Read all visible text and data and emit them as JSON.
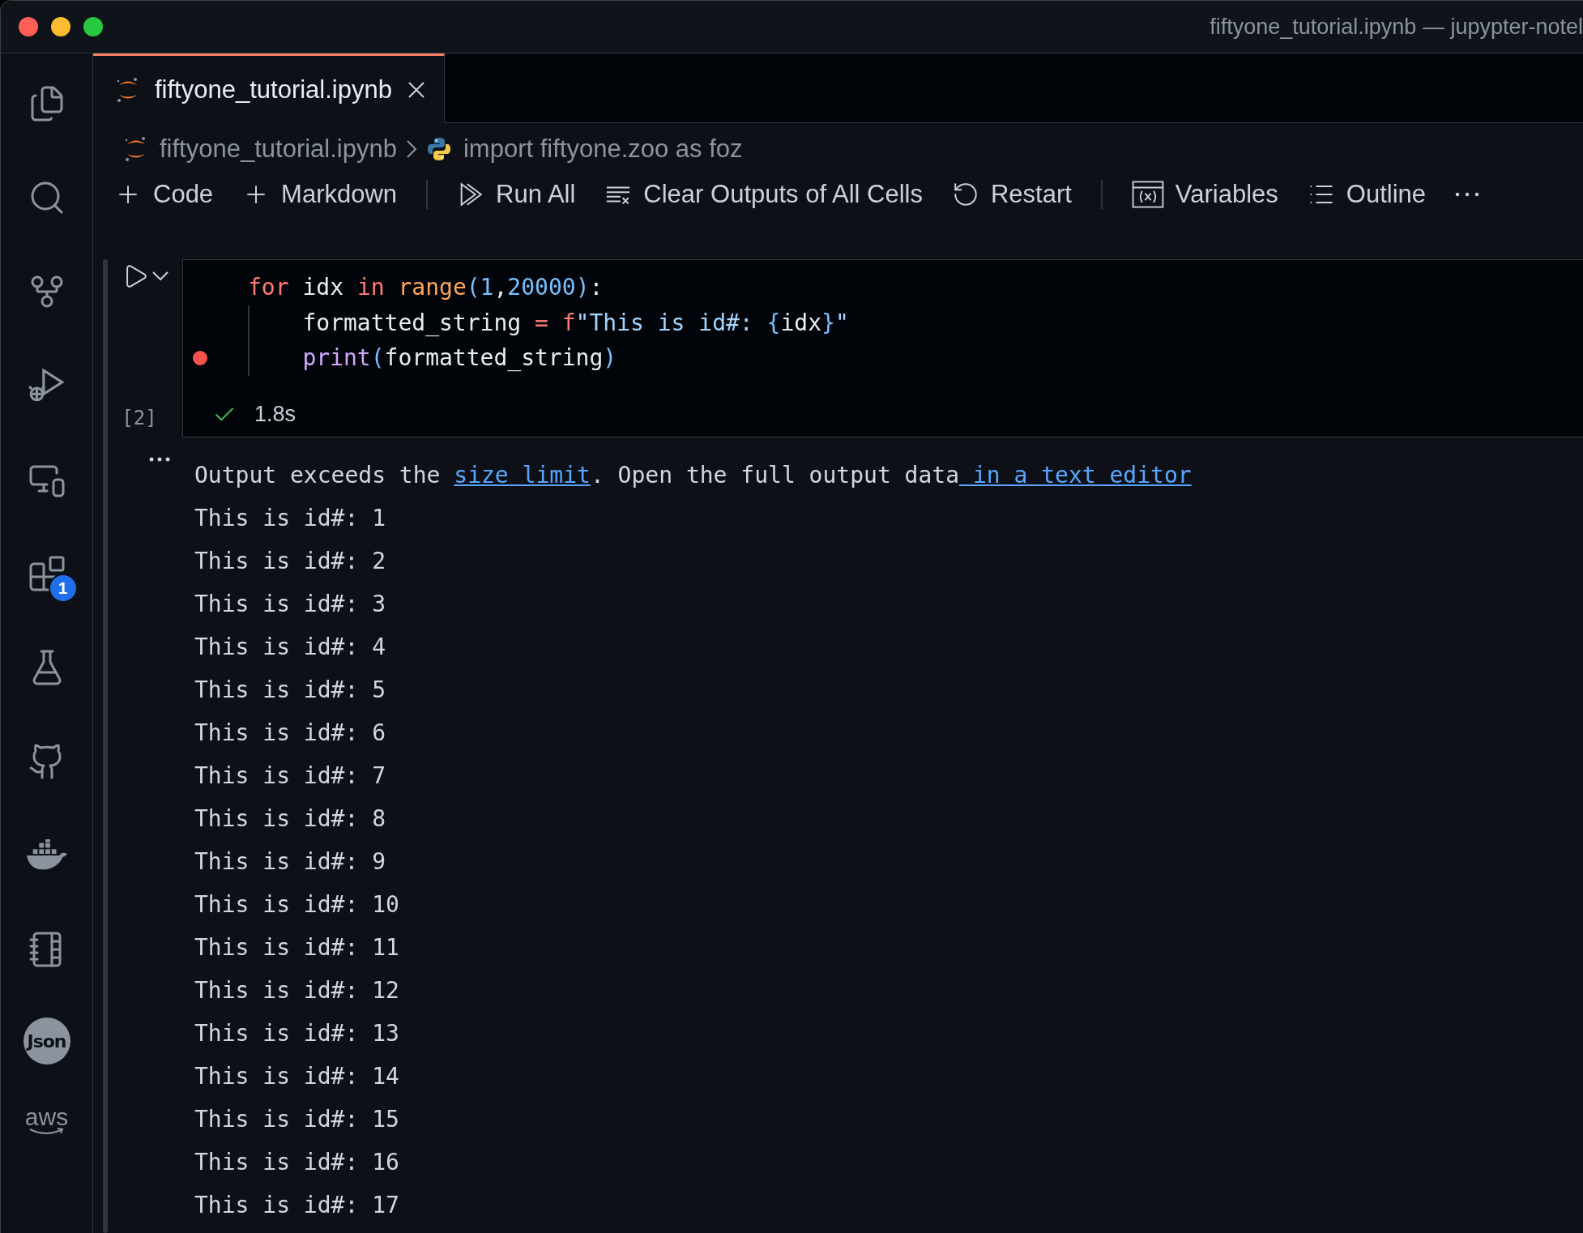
{
  "window": {
    "title": "fiftyone_tutorial.ipynb — jupypter-notel"
  },
  "activity_bar": [
    {
      "kind": "files"
    },
    {
      "kind": "search"
    },
    {
      "kind": "source-control"
    },
    {
      "kind": "run-debug"
    },
    {
      "kind": "remote"
    },
    {
      "kind": "extensions",
      "badge": "1"
    },
    {
      "kind": "testing"
    },
    {
      "kind": "github"
    },
    {
      "kind": "docker"
    },
    {
      "kind": "notebook"
    },
    {
      "kind": "json",
      "label": "Json"
    },
    {
      "kind": "aws",
      "label": "aws"
    }
  ],
  "tabs": [
    {
      "label": "fiftyone_tutorial.ipynb",
      "selected": true
    }
  ],
  "breadcrumb": [
    {
      "kind": "notebook",
      "text": "fiftyone_tutorial.ipynb"
    },
    {
      "kind": "python",
      "text": "import fiftyone.zoo as foz"
    }
  ],
  "toolbar": [
    {
      "kind": "add",
      "label": "Code"
    },
    {
      "kind": "add",
      "label": "Markdown"
    },
    {
      "kind": "separator"
    },
    {
      "kind": "run",
      "label": "Run All"
    },
    {
      "kind": "clear",
      "label": "Clear Outputs of All Cells"
    },
    {
      "kind": "restart",
      "label": "Restart"
    },
    {
      "kind": "separator"
    },
    {
      "kind": "variables",
      "label": "Variables"
    },
    {
      "kind": "outline",
      "label": "Outline"
    },
    {
      "kind": "more"
    }
  ],
  "cell": {
    "execution_count": "[2]",
    "duration": "1.8s",
    "succeeded": true,
    "lines": [
      {
        "indented": false,
        "breakpoint": false,
        "tokens": [
          {
            "kind": "keyword",
            "text": "for"
          },
          {
            "kind": "plain",
            "text": " idx "
          },
          {
            "kind": "keyword",
            "text": "in"
          },
          {
            "kind": "builtin",
            "text": " range"
          },
          {
            "kind": "paren",
            "text": "("
          },
          {
            "kind": "number",
            "text": "1"
          },
          {
            "kind": "plain",
            "text": ","
          },
          {
            "kind": "number",
            "text": "20000"
          },
          {
            "kind": "paren",
            "text": ")"
          },
          {
            "kind": "plain",
            "text": ":"
          }
        ]
      },
      {
        "indented": true,
        "breakpoint": false,
        "tokens": [
          {
            "kind": "plain",
            "text": "formatted_string "
          },
          {
            "kind": "keyword",
            "text": "= f"
          },
          {
            "kind": "string",
            "text": "\"This is id#: "
          },
          {
            "kind": "paren",
            "text": "{"
          },
          {
            "kind": "plain",
            "text": "idx"
          },
          {
            "kind": "paren",
            "text": "}"
          },
          {
            "kind": "string",
            "text": "\""
          }
        ]
      },
      {
        "indented": true,
        "breakpoint": true,
        "tokens": [
          {
            "kind": "function",
            "text": "print"
          },
          {
            "kind": "paren",
            "text": "("
          },
          {
            "kind": "plain",
            "text": "formatted_string"
          },
          {
            "kind": "paren",
            "text": ")"
          }
        ]
      }
    ]
  },
  "output": {
    "notice": [
      {
        "kind": "text",
        "text": "Output exceeds the "
      },
      {
        "kind": "link",
        "text": "size limit"
      },
      {
        "kind": "text",
        "text": ". Open the full output data"
      },
      {
        "kind": "link",
        "text": " in a text editor"
      }
    ],
    "lines": [
      "This is id#: 1",
      "This is id#: 2",
      "This is id#: 3",
      "This is id#: 4",
      "This is id#: 5",
      "This is id#: 6",
      "This is id#: 7",
      "This is id#: 8",
      "This is id#: 9",
      "This is id#: 10",
      "This is id#: 11",
      "This is id#: 12",
      "This is id#: 13",
      "This is id#: 14",
      "This is id#: 15",
      "This is id#: 16",
      "This is id#: 17"
    ]
  }
}
